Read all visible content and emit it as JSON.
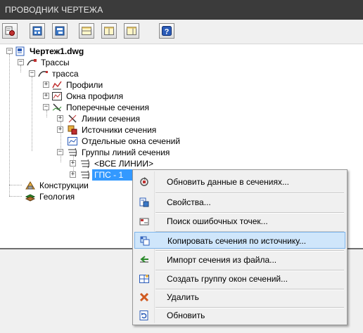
{
  "panel": {
    "title": "ПРОВОДНИК ЧЕРТЕЖА"
  },
  "toolbar": {
    "buttons": [
      {
        "icon": "drawing-settings-icon"
      },
      {
        "icon": "refresh-tree-icon"
      },
      {
        "icon": "tree-view-icon"
      },
      {
        "icon": "horizontal-split-icon"
      },
      {
        "icon": "vertical-split-icon"
      },
      {
        "icon": "vertical-split-alt-icon"
      },
      {
        "icon": "help-icon"
      }
    ]
  },
  "tree": {
    "root": "Чертеж1.dwg",
    "alignments": "Трассы",
    "alignment": "трасса",
    "profiles": "Профили",
    "profile_views": "Окна профиля",
    "cross_sections": "Поперечные сечения",
    "sample_lines": "Линии сечения",
    "section_sources": "Источники сечения",
    "section_views": "Отдельные окна сечений",
    "sample_line_groups": "Группы линий сечения",
    "all_lines": "<ВСЕ ЛИНИИ>",
    "gps": "ГПС - 1",
    "constructions": "Конструкции",
    "geology": "Геология"
  },
  "context_menu": {
    "items": [
      {
        "label": "Обновить данные в сечениях...",
        "icon": "update-sections-icon"
      },
      {
        "label": "Свойства...",
        "icon": "properties-icon"
      },
      {
        "label": "Поиск ошибочных точек...",
        "icon": "find-error-points-icon"
      },
      {
        "label": "Копировать сечения по источнику...",
        "icon": "copy-sections-icon"
      },
      {
        "label": "Импорт сечения из файла...",
        "icon": "import-section-icon"
      },
      {
        "label": "Создать группу окон сечений...",
        "icon": "create-view-group-icon"
      },
      {
        "label": "Удалить",
        "icon": "delete-icon"
      },
      {
        "label": "Обновить",
        "icon": "refresh-icon"
      }
    ]
  },
  "colors": {
    "title_bg": "#3b3b3b",
    "selection": "#3399ff",
    "menu_hover": "#cfe6fb"
  }
}
